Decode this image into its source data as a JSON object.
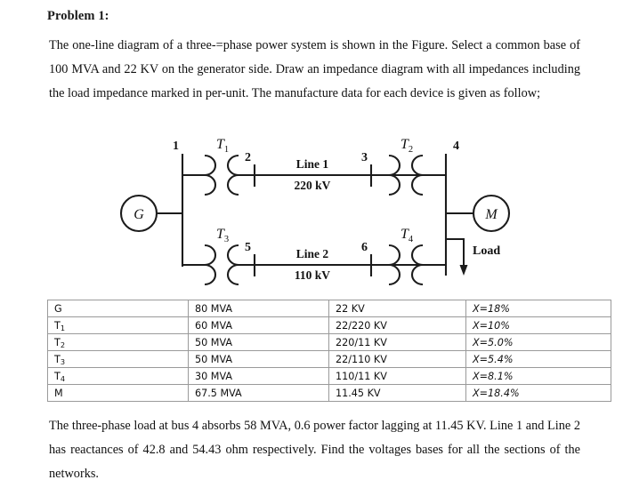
{
  "document": {
    "problem_title": "Problem 1:",
    "intro_paragraph": "The one-line diagram of a three-=phase power system is shown in the Figure. Select a common base of 100 MVA and 22 KV on the generator side. Draw an impedance diagram with all impedances including the load impedance marked in per-unit. The manufacture data for each device is given as follow;",
    "outro_paragraph": "The three-phase load at bus 4 absorbs 58 MVA, 0.6 power factor lagging at 11.45 KV. Line 1 and Line 2 has reactances of 42.8 and 54.43 ohm respectively. Find the voltages bases for all the sections of the networks."
  },
  "diagram": {
    "generator_label": "G",
    "motor_label": "M",
    "load_label": "Load",
    "bus_labels": {
      "bus1": "1",
      "bus2": "2",
      "bus3": "3",
      "bus4": "4",
      "bus5": "5",
      "bus6": "6"
    },
    "transformers": {
      "t1_base": "T",
      "t1_sub": "1",
      "t2_base": "T",
      "t2_sub": "2",
      "t3_base": "T",
      "t3_sub": "3",
      "t4_base": "T",
      "t4_sub": "4"
    },
    "lines": [
      {
        "name": "Line 1",
        "voltage": "220 kV"
      },
      {
        "name": "Line 2",
        "voltage": "110 kV"
      }
    ],
    "stroke_color": "#1c1c1c"
  },
  "device_table": {
    "rows": [
      {
        "device": "G",
        "device_sub": "",
        "mva": "80 MVA",
        "kv": "22 KV",
        "x": "X=18%"
      },
      {
        "device": "T",
        "device_sub": "1",
        "mva": "60 MVA",
        "kv": "22/220 KV",
        "x": "X=10%"
      },
      {
        "device": "T",
        "device_sub": "2",
        "mva": "50 MVA",
        "kv": "220/11 KV",
        "x": "X=5.0%"
      },
      {
        "device": "T",
        "device_sub": "3",
        "mva": "50 MVA",
        "kv": "22/110 KV",
        "x": "X=5.4%"
      },
      {
        "device": "T",
        "device_sub": "4",
        "mva": "30 MVA",
        "kv": "110/11 KV",
        "x": "X=8.1%"
      },
      {
        "device": "M",
        "device_sub": "",
        "mva": "67.5 MVA",
        "kv": "11.45 KV",
        "x": "X=18.4%"
      }
    ]
  }
}
